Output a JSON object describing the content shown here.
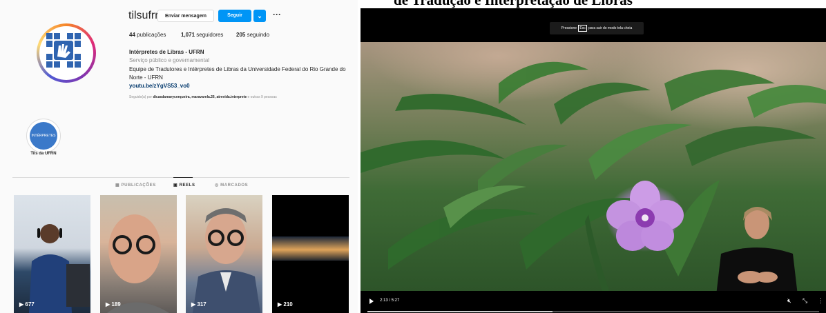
{
  "caption": "de Tradução e Interpretação de Libras",
  "instagram": {
    "username": "tilsufrn",
    "buttons": {
      "message": "Enviar mensagem",
      "follow": "Seguir",
      "dropdown": "⌄",
      "more": "···"
    },
    "stats": {
      "posts_count": "44",
      "posts_label": "publicações",
      "followers_count": "1,071",
      "followers_label": "seguidores",
      "following_count": "205",
      "following_label": "seguindo"
    },
    "profile": {
      "display_name": "Intérpretes de Libras - UFRN",
      "category": "Serviço público e governamental",
      "bio": "Equipe de Tradutores e Intérpretes de Libras da Universidade Federal do Rio Grande do Norte - UFRN",
      "link": "youtu.be/zYgVS53_vo0",
      "followed_by_prefix": "Seguido(a) por",
      "followed_by_names": "dicasdamarycerqueira, maravarela.26, atrevida.interprete",
      "followed_by_suffix": "e outras 9 pessoas"
    },
    "highlight": {
      "circle_text": "INTÉRPRETES",
      "label": "Tils da UFRN"
    },
    "tabs": [
      {
        "label": "PUBLICAÇÕES",
        "icon": "grid-icon"
      },
      {
        "label": "REELS",
        "icon": "reels-icon"
      },
      {
        "label": "MARCADOS",
        "icon": "tagged-icon"
      }
    ],
    "reels": [
      {
        "views": "677"
      },
      {
        "views": "189"
      },
      {
        "views": "317"
      },
      {
        "views": "210"
      }
    ]
  },
  "video": {
    "fullscreen_toast_prefix": "Pressione",
    "fullscreen_toast_key": "Esc",
    "fullscreen_toast_suffix": "para sair do modo tela cheia",
    "time": "2:13 / 5:27",
    "progress_fraction": 0.41
  }
}
